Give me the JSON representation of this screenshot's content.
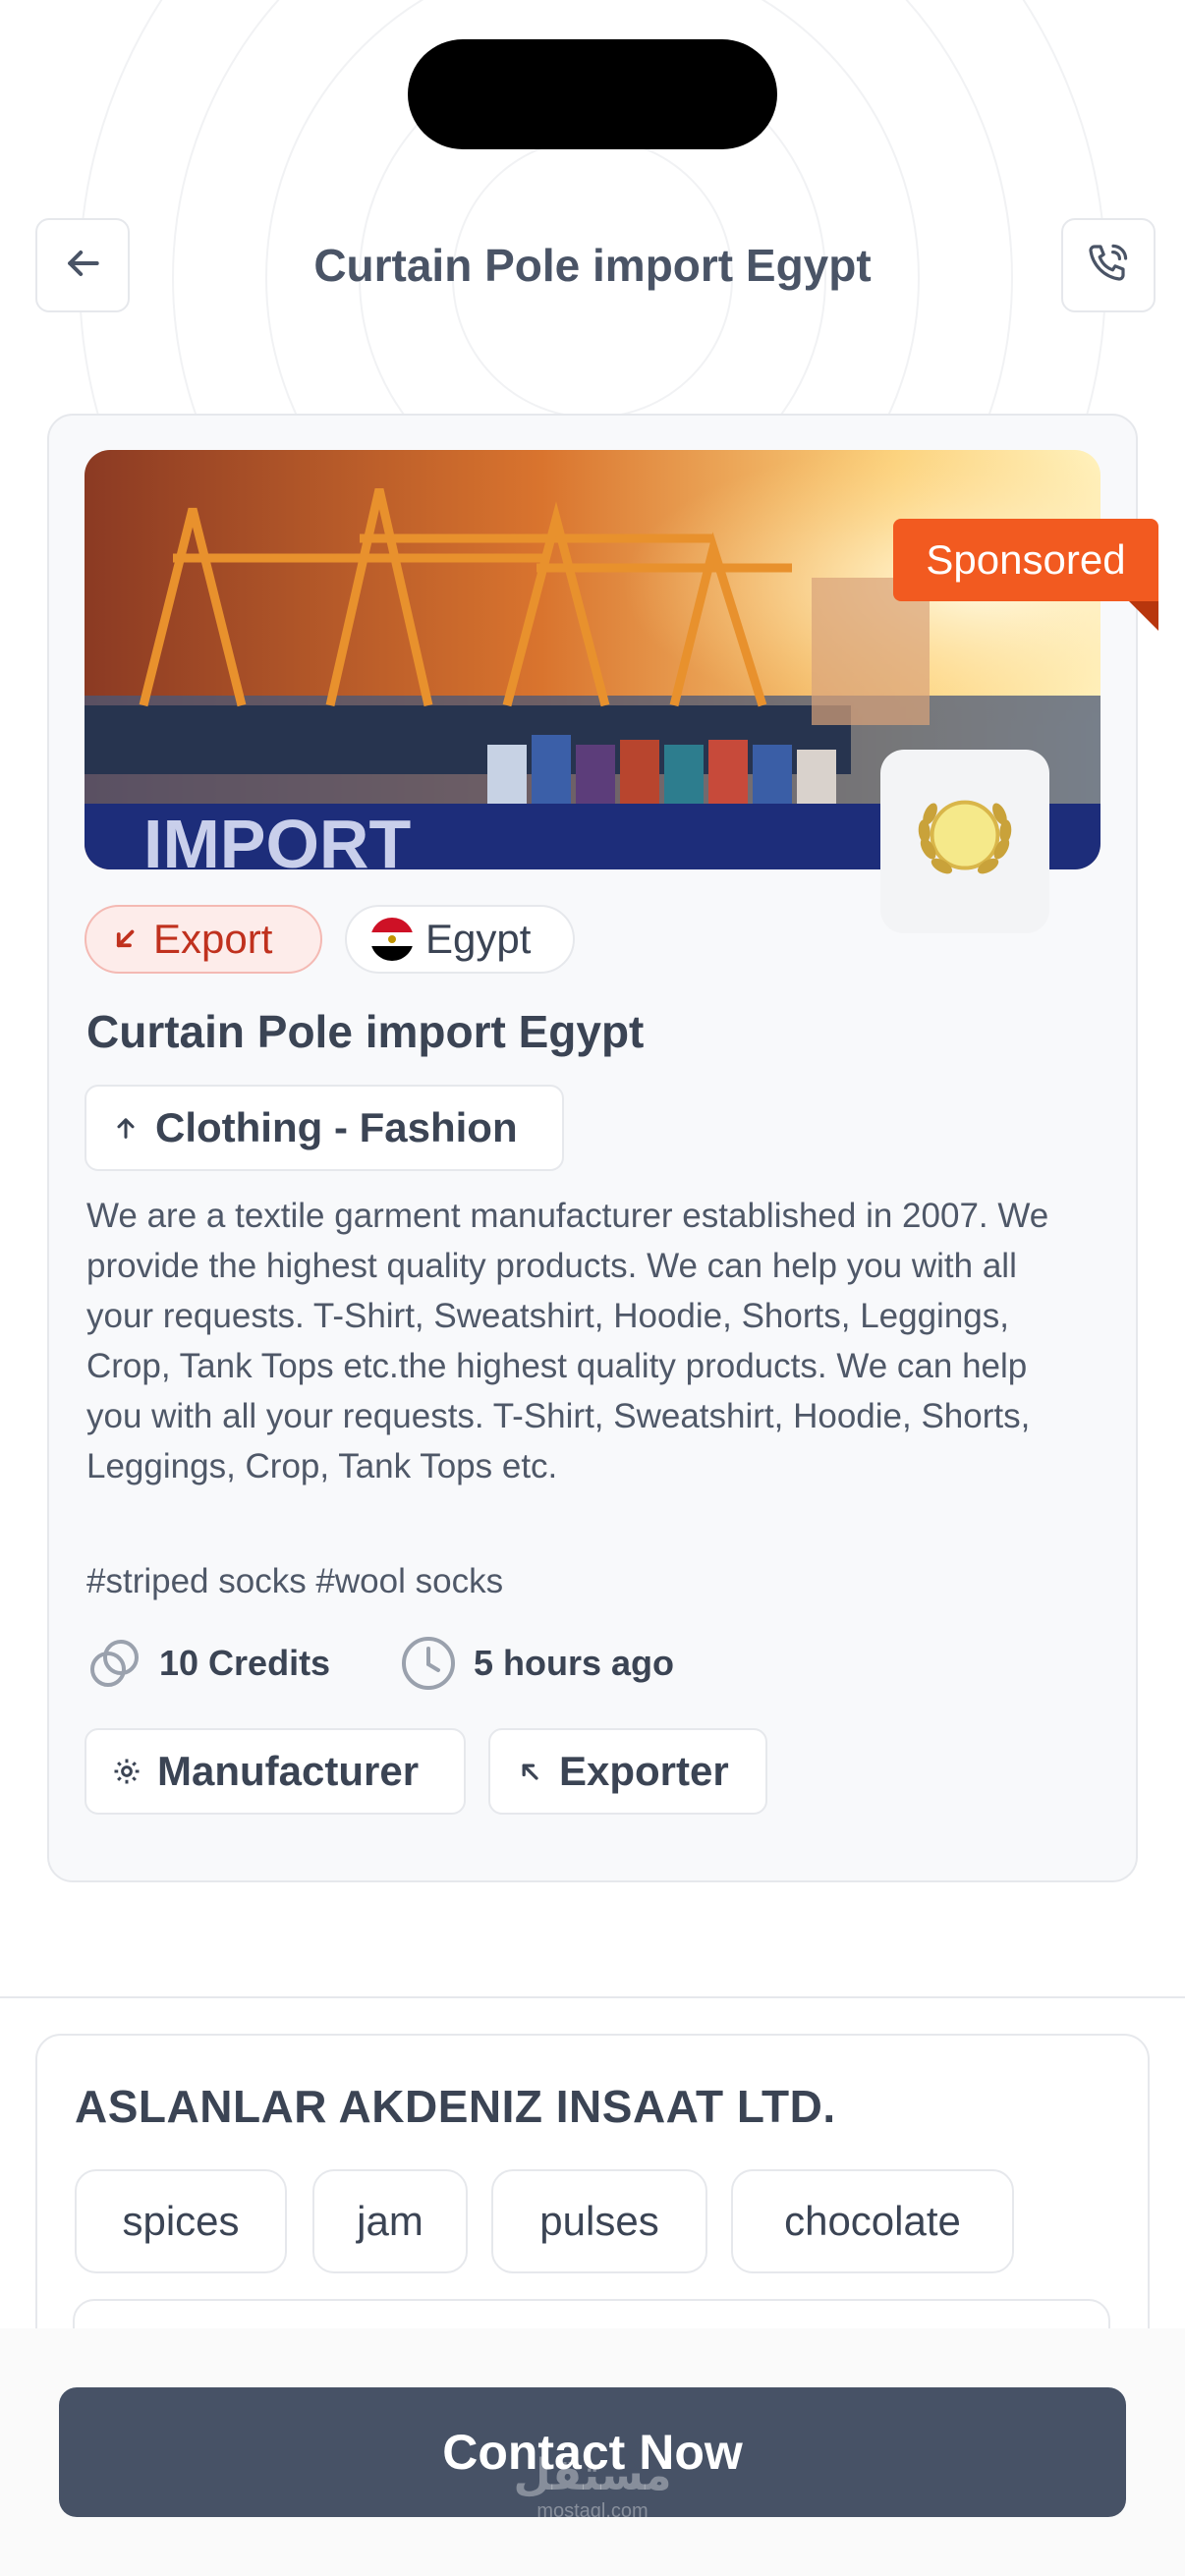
{
  "header": {
    "title": "Curtain Pole import Egypt",
    "back_icon": "arrow-left-icon",
    "call_icon": "phone-icon"
  },
  "listing": {
    "sponsored_label": "Sponsored",
    "trade_type": "Export",
    "country": "Egypt",
    "title": "Curtain Pole import Egypt",
    "category": "Clothing - Fashion",
    "description": "We are a textile garment manufacturer established in 2007. We provide the highest quality products. We can help you with all your requests. T-Shirt, Sweatshirt, Hoodie, Shorts, Leggings, Crop, Tank Tops etc.the highest quality products. We can help you with all your requests. T-Shirt, Sweatshirt, Hoodie, Shorts, Leggings, Crop, Tank Tops etc.",
    "hashtags": "#striped socks #wool socks",
    "credits": "10 Credits",
    "posted": "5 hours ago",
    "roles": [
      "Manufacturer",
      "Exporter"
    ],
    "badge_icon": "laurel-wreath-icon"
  },
  "company": {
    "name": "ASLANLAR AKDENIZ INSAAT LTD.",
    "keywords": [
      "spices",
      "jam",
      "pulses",
      "chocolate"
    ]
  },
  "cta": {
    "label": "Contact Now"
  },
  "watermark": {
    "arabic": "مستقل",
    "latin": "mostaql.com"
  },
  "colors": {
    "accent": "#475266",
    "sponsored": "#f25a20",
    "export_text": "#c0311e",
    "export_bg": "#fdecea"
  }
}
